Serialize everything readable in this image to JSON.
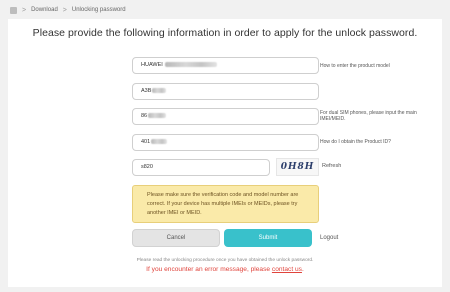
{
  "breadcrumb": {
    "items": [
      "Download",
      "Unlocking password"
    ],
    "separator": ">"
  },
  "title": "Please provide the following information in order to apply for the unlock password.",
  "fields": {
    "product_model": {
      "value": "HUAWEI ",
      "hint": "How to enter the product model"
    },
    "imei1": {
      "value": "A3B"
    },
    "imei2": {
      "value": "86",
      "hint": "For dual SIM phones, please input the main IMEI/MEID."
    },
    "product_id": {
      "value": "401",
      "hint": "How do I obtain the Product ID?"
    }
  },
  "captcha": {
    "input_value": "s820",
    "image_text": "0H8H",
    "refresh_label": "Refresh"
  },
  "notice": "Please make sure the verification code and model number are correct. If your device has multiple IMEIs or MEIDs, please try another IMEI or MEID.",
  "actions": {
    "cancel_label": "Cancel",
    "submit_label": "Submit",
    "logout_label": "Logout"
  },
  "footnote": "Please read the unlocking procedure once you have obtained the unlock password.",
  "error": {
    "text": "If you encounter an error message, please ",
    "link_label": "contact us",
    "suffix": "."
  },
  "colors": {
    "accent": "#39c1cb",
    "notice_bg": "#faeaa9",
    "error": "#e0443c"
  },
  "icons": {
    "home": "home-icon"
  }
}
